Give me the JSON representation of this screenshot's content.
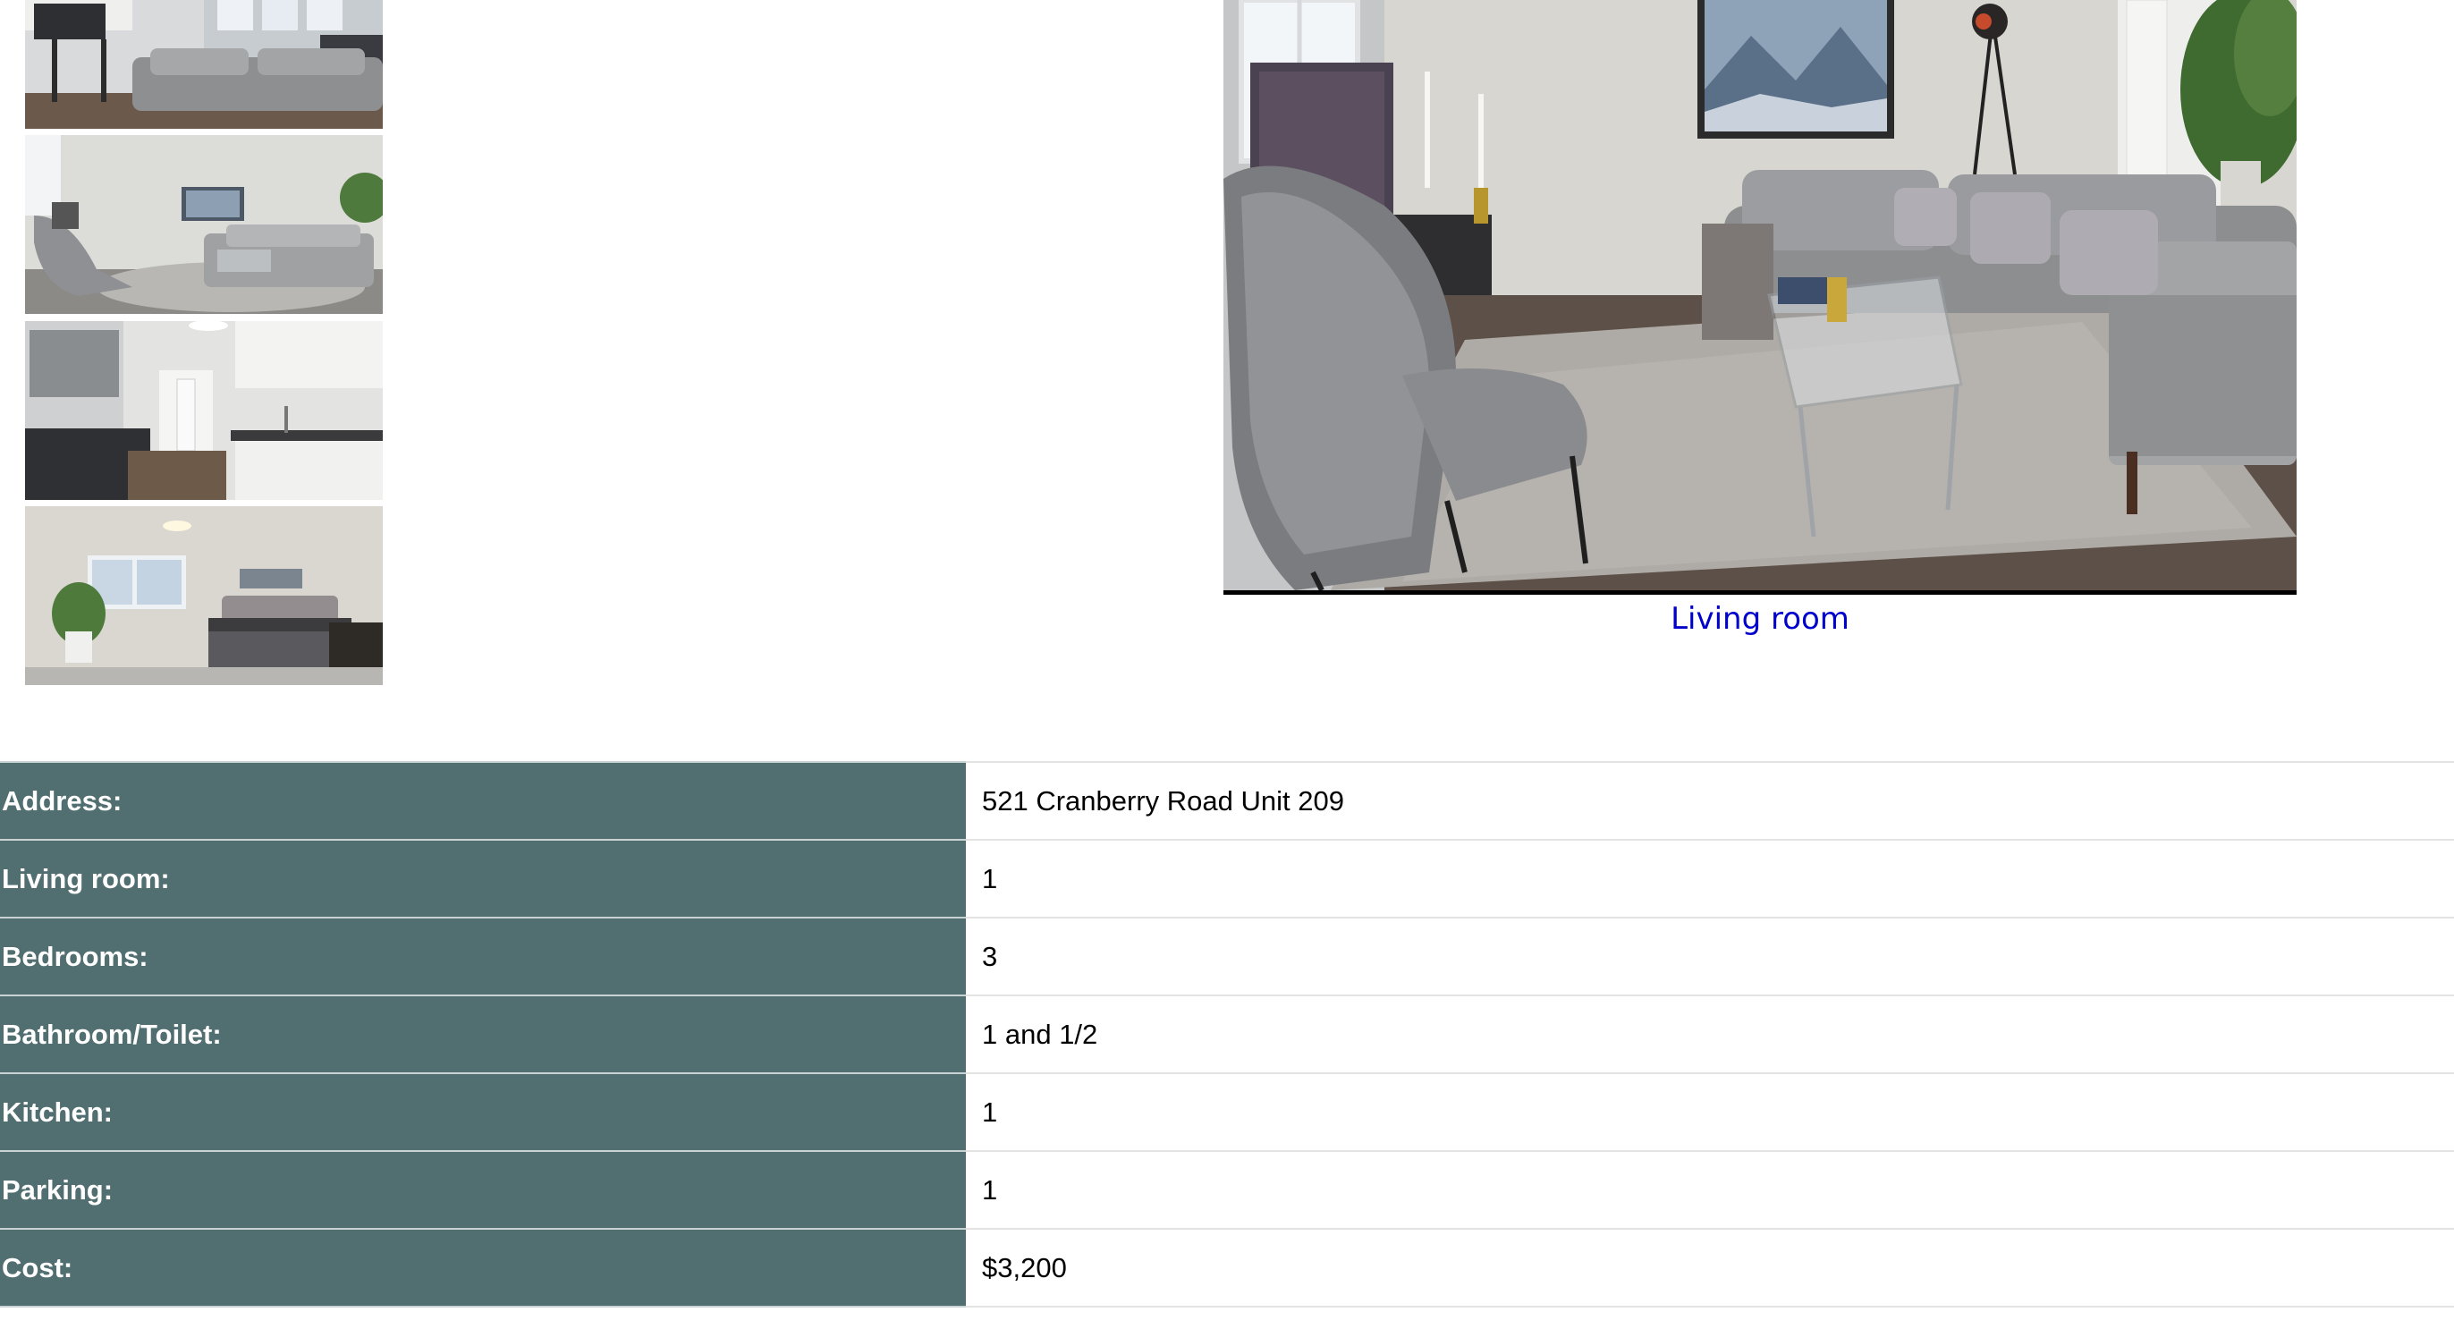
{
  "gallery": {
    "thumbnails": [
      {
        "icon": "living-room-photo"
      },
      {
        "icon": "living-room-photo"
      },
      {
        "icon": "kitchen-photo"
      },
      {
        "icon": "bedroom-photo"
      }
    ],
    "main_photo": {
      "icon": "living-room-photo"
    },
    "caption": "Living room"
  },
  "details": {
    "rows": [
      {
        "label": "Address:",
        "value": "521 Cranberry Road Unit 209"
      },
      {
        "label": "Living room:",
        "value": "1"
      },
      {
        "label": "Bedrooms:",
        "value": "3"
      },
      {
        "label": "Bathroom/Toilet:",
        "value": "1 and 1/2"
      },
      {
        "label": "Kitchen:",
        "value": "1"
      },
      {
        "label": "Parking:",
        "value": "1"
      },
      {
        "label": "Cost:",
        "value": "$3,200"
      }
    ]
  },
  "colors": {
    "label_bg": "#516e71",
    "caption_link": "#0000cc"
  }
}
